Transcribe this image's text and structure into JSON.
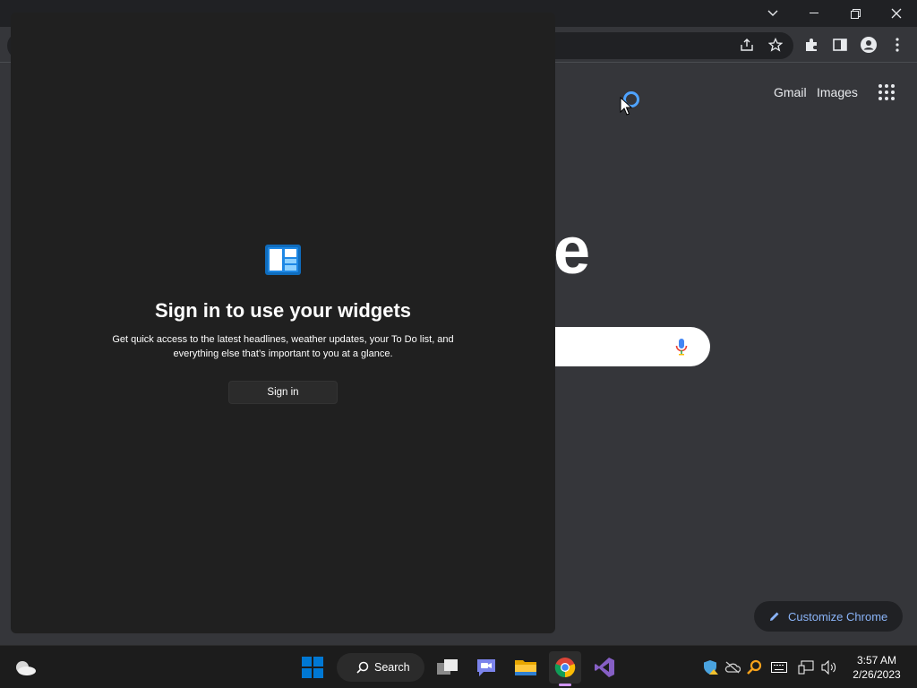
{
  "chrome": {
    "ntp": {
      "gmail_label": "Gmail",
      "images_label": "Images",
      "logo_fragment": "e",
      "customize_label": "Customize Chrome"
    },
    "icons": [
      "share-icon",
      "star-icon",
      "extensions-icon",
      "side-panel-icon",
      "profile-icon",
      "menu-icon",
      "apps-grid-icon",
      "mic-icon",
      "pencil-icon"
    ]
  },
  "widgets": {
    "title": "Sign in to use your widgets",
    "description": "Get quick access to the latest headlines, weather updates, your To Do list, and everything else that’s important to you at a glance.",
    "signin_label": "Sign in"
  },
  "taskbar": {
    "search_label": "Search",
    "time": "3:57 AM",
    "date": "2/26/2023",
    "accent_color": "#0078d4"
  }
}
